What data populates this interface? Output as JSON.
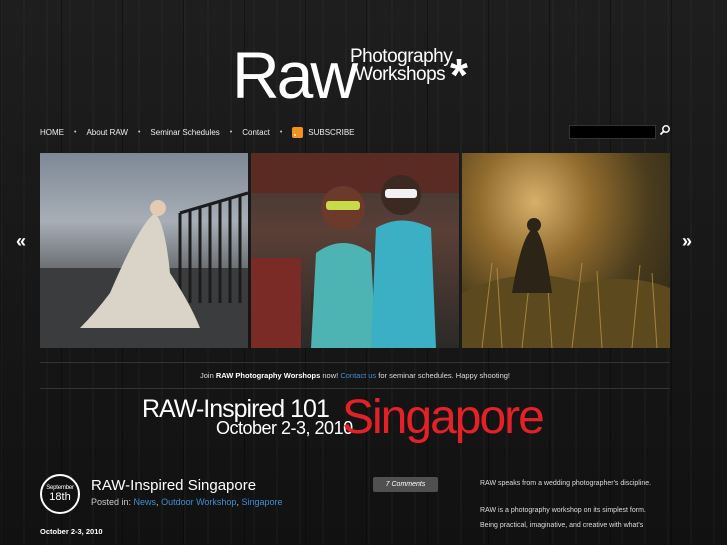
{
  "logo": {
    "raw": "Raw",
    "line1": "Photography",
    "line2": "Workshops",
    "asterisk": "*"
  },
  "nav": {
    "items": [
      "HOME",
      "About RAW",
      "Seminar Schedules",
      "Contact"
    ],
    "subscribe": "SUBSCRIBE",
    "separator": "•"
  },
  "search": {
    "placeholder": ""
  },
  "slider": {
    "prev": "«",
    "next": "»"
  },
  "notice": {
    "prefix": "Join ",
    "bold": "RAW Photography Worshops",
    "mid": " now! ",
    "link": "Contact us",
    "suffix": " for seminar schedules. Happy shooting!"
  },
  "banner": {
    "line1": "RAW-Inspired 101",
    "line2": "October 2-3, 2010",
    "city": "Singapore"
  },
  "post": {
    "month": "September",
    "day": "18th",
    "title": "RAW-Inspired Singapore",
    "posted_in_label": "Posted in: ",
    "categories": [
      "News",
      "Outdoor Workshop",
      "Singapore"
    ],
    "comments": "7 Comments",
    "date": "October 2-3, 2010"
  },
  "sidebar": {
    "p1": "RAW speaks from a wedding photographer's discipline.",
    "p2": "RAW is a photography workshop on its simplest form. Being practical, imaginative, and creative with what's"
  },
  "colors": {
    "accent_link": "#3f8fd4",
    "banner_red": "#e42127",
    "rss": "#f29222"
  }
}
